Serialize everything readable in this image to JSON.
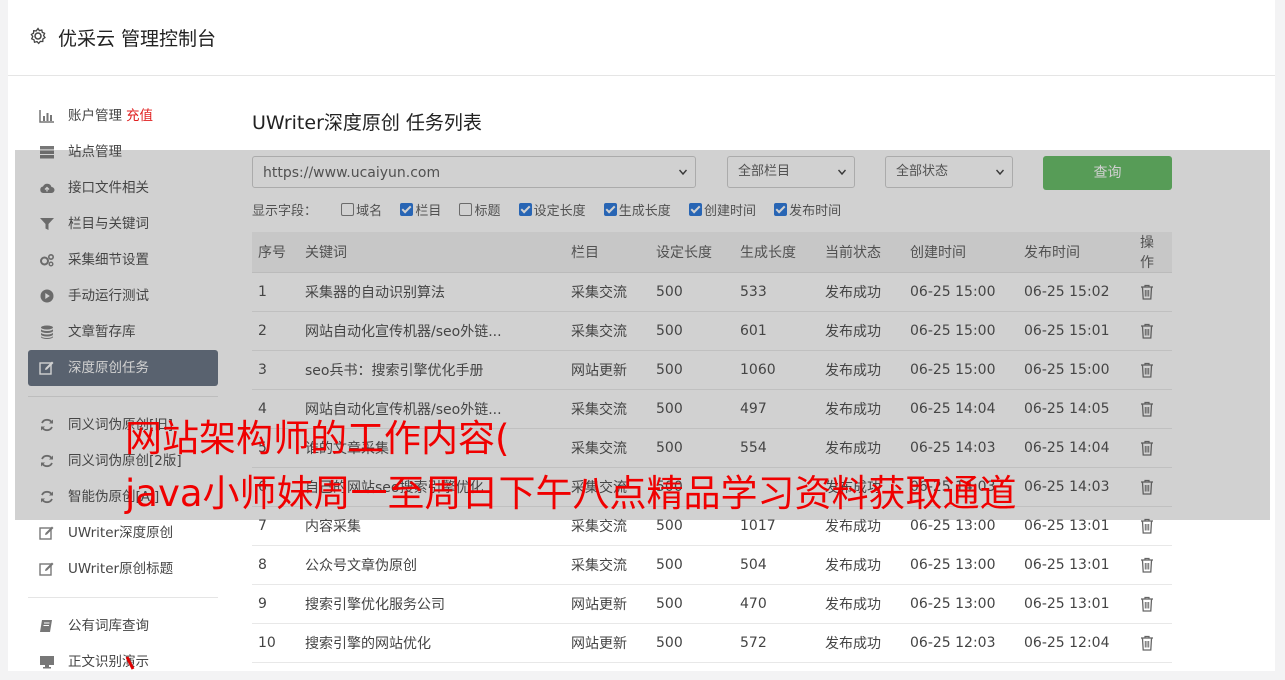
{
  "header": {
    "title": "优采云 管理控制台",
    "icon": "gear-icon"
  },
  "sidebar": {
    "group1": [
      {
        "label": "账户管理",
        "badge": "充值",
        "icon": "bar-chart-icon"
      },
      {
        "label": "站点管理",
        "icon": "server-icon"
      },
      {
        "label": "接口文件相关",
        "icon": "cloud-upload-icon"
      },
      {
        "label": "栏目与关键词",
        "icon": "filter-icon"
      },
      {
        "label": "采集细节设置",
        "icon": "gears-icon"
      },
      {
        "label": "手动运行测试",
        "icon": "play-circle-icon"
      },
      {
        "label": "文章暂存库",
        "icon": "database-icon"
      },
      {
        "label": "深度原创任务",
        "icon": "edit-icon",
        "active": true
      }
    ],
    "group2": [
      {
        "label": "同义词伪原创[旧]",
        "icon": "refresh-icon"
      },
      {
        "label": "同义词伪原创[2版]",
        "icon": "refresh-icon"
      },
      {
        "label": "智能伪原创[AI]",
        "icon": "refresh-icon"
      },
      {
        "label": "UWriter深度原创",
        "icon": "edit-icon"
      },
      {
        "label": "UWriter原创标题",
        "icon": "edit-icon"
      }
    ],
    "group3": [
      {
        "label": "公有词库查询",
        "icon": "book-icon"
      },
      {
        "label": "正文识别演示",
        "icon": "monitor-icon"
      }
    ]
  },
  "main": {
    "title": "UWriter深度原创 任务列表",
    "filters": {
      "site": "https://www.ucaiyun.com",
      "column": "全部栏目",
      "status": "全部状态",
      "query_label": "查询"
    },
    "fields_label": "显示字段：",
    "fields": [
      {
        "label": "域名",
        "checked": false
      },
      {
        "label": "栏目",
        "checked": true
      },
      {
        "label": "标题",
        "checked": false
      },
      {
        "label": "设定长度",
        "checked": true
      },
      {
        "label": "生成长度",
        "checked": true
      },
      {
        "label": "创建时间",
        "checked": true
      },
      {
        "label": "发布时间",
        "checked": true
      }
    ],
    "table": {
      "headers": [
        "序号",
        "关键词",
        "栏目",
        "设定长度",
        "生成长度",
        "当前状态",
        "创建时间",
        "发布时间",
        "操作"
      ],
      "rows": [
        [
          "1",
          "采集器的自动识别算法",
          "采集交流",
          "500",
          "533",
          "发布成功",
          "06-25 15:00",
          "06-25 15:02"
        ],
        [
          "2",
          "网站自动化宣传机器/seo外链...",
          "采集交流",
          "500",
          "601",
          "发布成功",
          "06-25 15:00",
          "06-25 15:01"
        ],
        [
          "3",
          "seo兵书：搜索引擎优化手册",
          "网站更新",
          "500",
          "1060",
          "发布成功",
          "06-25 15:00",
          "06-25 15:00"
        ],
        [
          "4",
          "网站自动化宣传机器/seo外链...",
          "采集交流",
          "500",
          "497",
          "发布成功",
          "06-25 14:04",
          "06-25 14:05"
        ],
        [
          "5",
          "谁的文章采集",
          "采集交流",
          "500",
          "554",
          "发布成功",
          "06-25 14:03",
          "06-25 14:04"
        ],
        [
          "6",
          "自己的网站seo搜索引擎优化",
          "采集交流",
          "500",
          "",
          "发布成功",
          "06-25 14:03",
          "06-25 14:03"
        ],
        [
          "7",
          "内容采集",
          "采集交流",
          "500",
          "1017",
          "发布成功",
          "06-25 13:00",
          "06-25 13:01"
        ],
        [
          "8",
          "公众号文章伪原创",
          "采集交流",
          "500",
          "504",
          "发布成功",
          "06-25 13:00",
          "06-25 13:01"
        ],
        [
          "9",
          "搜索引擎优化服务公司",
          "网站更新",
          "500",
          "470",
          "发布成功",
          "06-25 13:00",
          "06-25 13:01"
        ],
        [
          "10",
          "搜索引擎的网站优化",
          "网站更新",
          "500",
          "572",
          "发布成功",
          "06-25 12:03",
          "06-25 12:04"
        ]
      ]
    }
  },
  "watermark": {
    "line1": "网站架构师的工作内容(",
    "line2": "java小师妹周一至周日下午八点精品学习资料获取通道"
  }
}
